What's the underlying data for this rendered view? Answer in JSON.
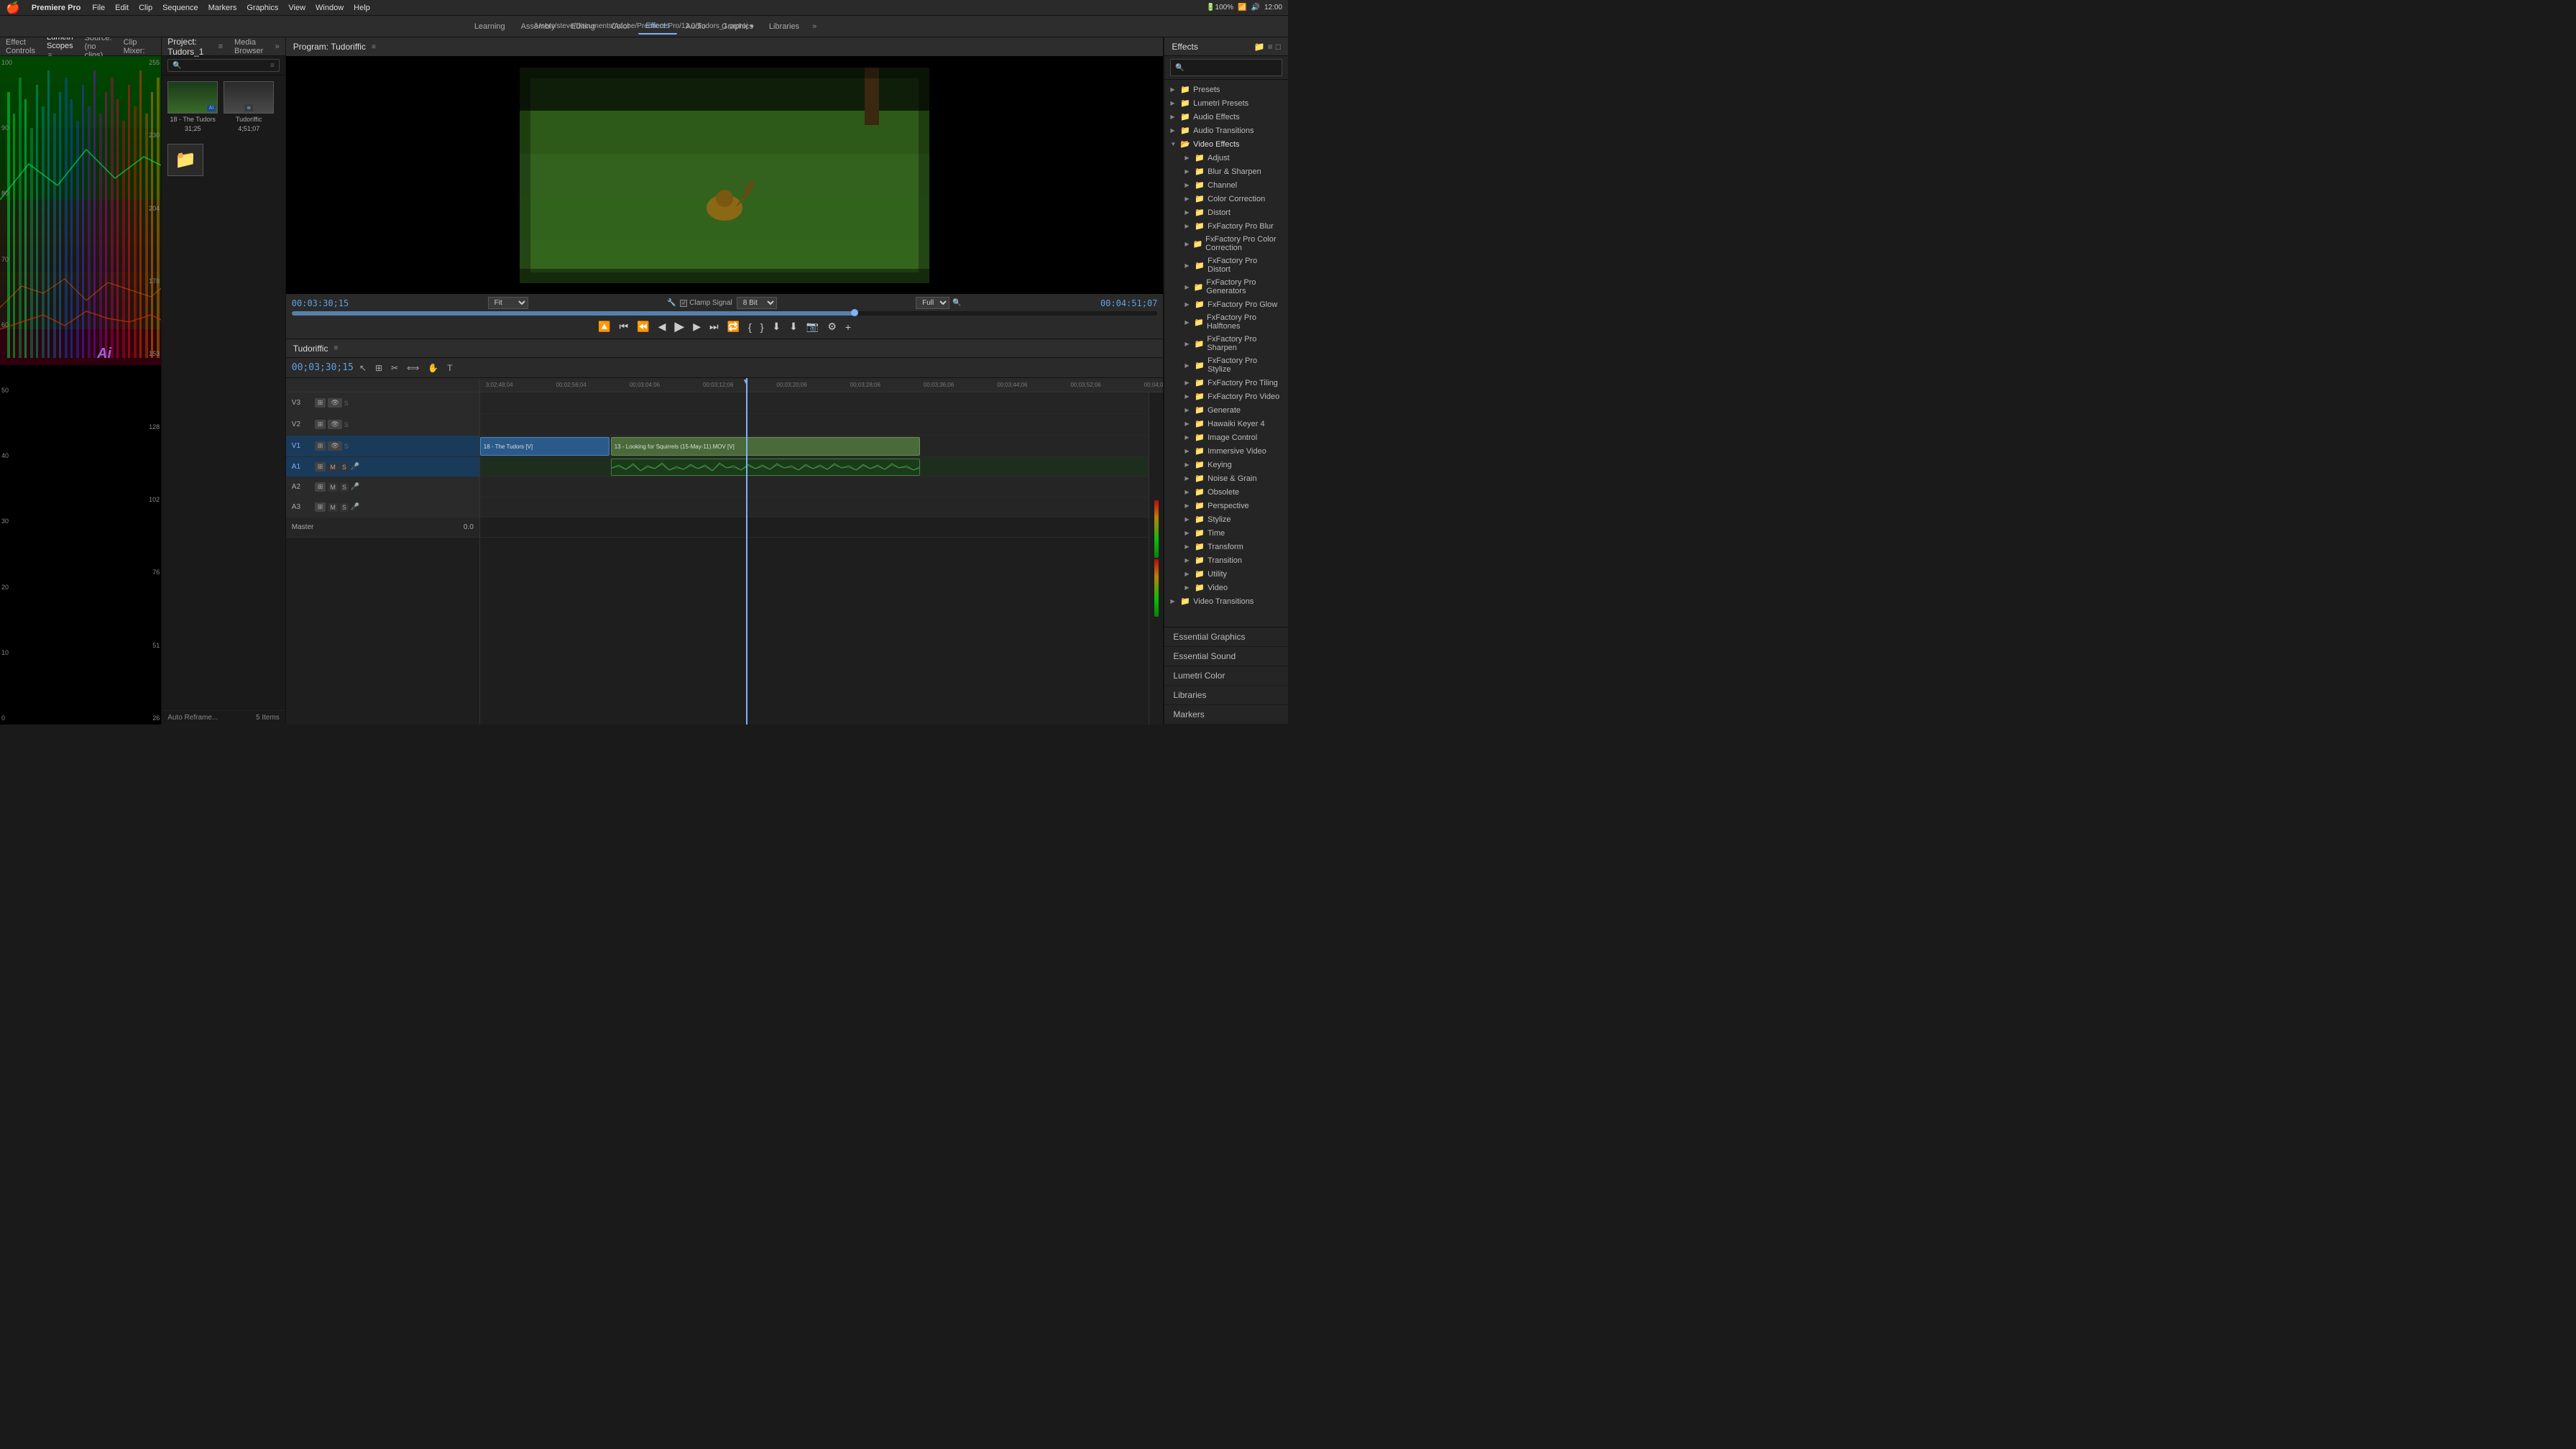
{
  "menubar": {
    "apple": "🍎",
    "app": "Premiere Pro",
    "menus": [
      "File",
      "Edit",
      "Clip",
      "Sequence",
      "Markers",
      "Graphics",
      "View",
      "Window",
      "Help"
    ]
  },
  "header": {
    "title": "/Users/steve/Documents/Adobe/Premiere Pro/13.0/Tudors_1.prproj ●",
    "workspace_tabs": [
      "Learning",
      "Assembly",
      "Editing",
      "Color",
      "Effects",
      "Audio",
      "Graphics",
      "Libraries"
    ],
    "active_tab": "Effects"
  },
  "left_panel": {
    "tabs": [
      "Effect Controls",
      "Lumetri Scopes",
      "Source: (no clips)",
      "Audio Clip Mixer: Tudoriffic"
    ],
    "active_tab": "Lumetri Scopes",
    "scope_numbers_left": [
      "100",
      "90",
      "80",
      "70",
      "60",
      "50",
      "40",
      "30",
      "20",
      "10",
      "0"
    ],
    "scope_numbers_right": [
      "255",
      "230",
      "204",
      "178",
      "153",
      "128",
      "102",
      "76",
      "51",
      "26"
    ]
  },
  "program_monitor": {
    "title": "Program: Tudoriffic",
    "timecode_in": "00:03:30;15",
    "timecode_out": "00:04:51;07",
    "fit_label": "Fit",
    "quality_label": "Full",
    "clamp_signal": "Clamp Signal",
    "bit_depth": "8 Bit"
  },
  "timeline": {
    "title": "Tudoriffic",
    "timecode": "00;03;30;15",
    "timecodes_ruler": [
      "3:02;48;04",
      "00;02;56;04",
      "00;03;04;06",
      "00;03;12;06",
      "00;03;20;06",
      "00;03;28;06",
      "00;03;36;06",
      "00;03;44;06",
      "00;03;52;06",
      "00;04;0"
    ],
    "tracks": [
      {
        "label": "V3",
        "type": "video"
      },
      {
        "label": "V2",
        "type": "video"
      },
      {
        "label": "V1",
        "type": "video",
        "clip1": "18 - The Tudors [V]",
        "clip2": "13 - Looking for Squirrels (15-May-11).MOV [V]"
      },
      {
        "label": "A1",
        "type": "audio",
        "clip1": "audio waveform"
      },
      {
        "label": "A2",
        "type": "audio"
      },
      {
        "label": "A3",
        "type": "audio"
      },
      {
        "label": "Master",
        "type": "master",
        "value": "0.0"
      }
    ]
  },
  "project_panel": {
    "title": "Project: Tudors_1",
    "tab2": "Media Browser",
    "search_placeholder": "",
    "items": [
      {
        "name": "18 - The Tudors",
        "duration": "31;25",
        "type": "video"
      },
      {
        "name": "Tudoriffic",
        "duration": "4;51;07",
        "type": "sequence"
      }
    ],
    "footer_label": "Auto Reframe...",
    "item_count": "5 Items"
  },
  "effects_panel": {
    "title": "Effects",
    "search_placeholder": "",
    "tree": [
      {
        "label": "Presets",
        "type": "folder",
        "expanded": false
      },
      {
        "label": "Lumetri Presets",
        "type": "folder",
        "expanded": false
      },
      {
        "label": "Audio Effects",
        "type": "folder",
        "expanded": false
      },
      {
        "label": "Audio Transitions",
        "type": "folder",
        "expanded": false
      },
      {
        "label": "Video Effects",
        "type": "folder",
        "expanded": true,
        "children": [
          {
            "label": "Adjust",
            "type": "folder"
          },
          {
            "label": "Blur & Sharpen",
            "type": "folder"
          },
          {
            "label": "Channel",
            "type": "folder"
          },
          {
            "label": "Color Correction",
            "type": "folder"
          },
          {
            "label": "Distort",
            "type": "folder"
          },
          {
            "label": "FxFactory Pro Blur",
            "type": "folder"
          },
          {
            "label": "FxFactory Pro Color Correction",
            "type": "folder"
          },
          {
            "label": "FxFactory Pro Distort",
            "type": "folder"
          },
          {
            "label": "FxFactory Pro Generators",
            "type": "folder"
          },
          {
            "label": "FxFactory Pro Glow",
            "type": "folder"
          },
          {
            "label": "FxFactory Pro Halftones",
            "type": "folder"
          },
          {
            "label": "FxFactory Pro Sharpen",
            "type": "folder"
          },
          {
            "label": "FxFactory Pro Stylize",
            "type": "folder"
          },
          {
            "label": "FxFactory Pro Tiling",
            "type": "folder"
          },
          {
            "label": "FxFactory Pro Video",
            "type": "folder"
          },
          {
            "label": "Generate",
            "type": "folder"
          },
          {
            "label": "Hawaiki Keyer 4",
            "type": "folder"
          },
          {
            "label": "Image Control",
            "type": "folder"
          },
          {
            "label": "Immersive Video",
            "type": "folder"
          },
          {
            "label": "Keying",
            "type": "folder"
          },
          {
            "label": "Noise & Grain",
            "type": "folder"
          },
          {
            "label": "Obsolete",
            "type": "folder"
          },
          {
            "label": "Perspective",
            "type": "folder"
          },
          {
            "label": "Stylize",
            "type": "folder"
          },
          {
            "label": "Time",
            "type": "folder"
          },
          {
            "label": "Transform",
            "type": "folder"
          },
          {
            "label": "Transition",
            "type": "folder"
          },
          {
            "label": "Utility",
            "type": "folder"
          },
          {
            "label": "Video",
            "type": "folder"
          }
        ]
      },
      {
        "label": "Video Transitions",
        "type": "folder",
        "expanded": false
      }
    ],
    "bottom_items": [
      "Essential Graphics",
      "Essential Sound",
      "Lumetri Color",
      "Libraries",
      "Markers"
    ]
  },
  "ai_label": "Ai"
}
